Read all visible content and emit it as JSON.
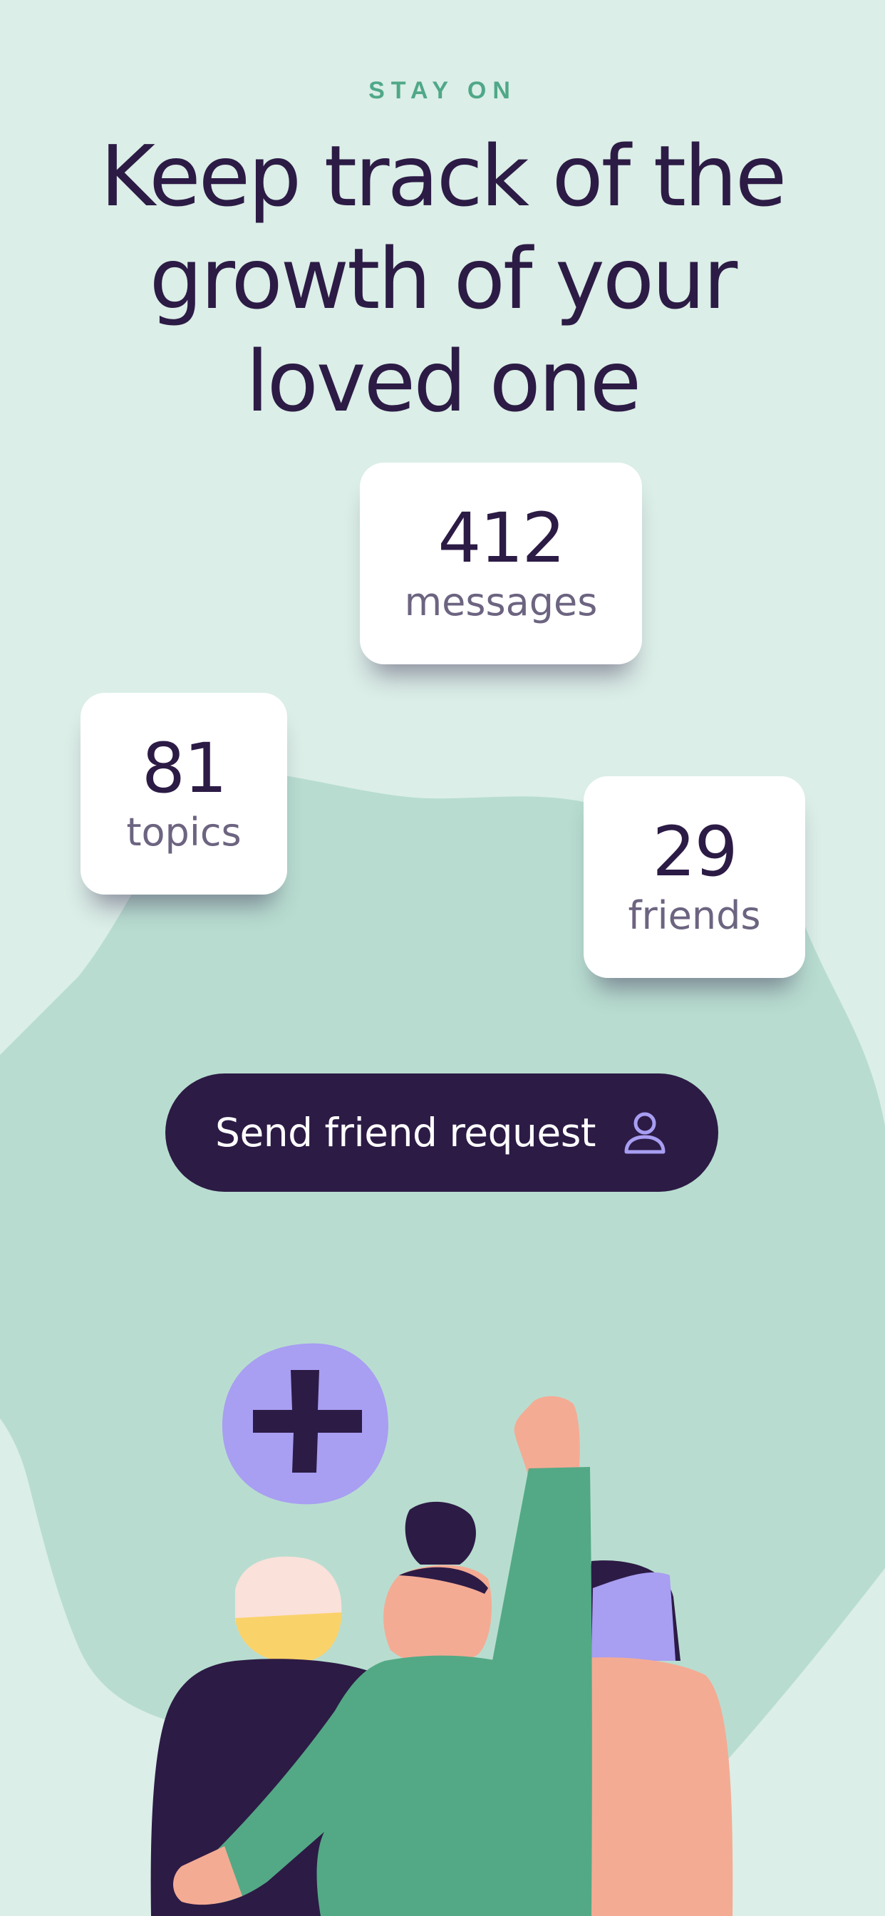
{
  "header": {
    "eyebrow": "STAY ON",
    "headline": "Keep track of the growth of your loved one"
  },
  "stats": {
    "messages": {
      "value": "412",
      "label": "messages"
    },
    "topics": {
      "value": "81",
      "label": "topics"
    },
    "friends": {
      "value": "29",
      "label": "friends"
    }
  },
  "cta": {
    "label": "Send friend request",
    "icon": "user-icon"
  },
  "illustration": {
    "icon": "plus-icon"
  },
  "colors": {
    "background": "#dbeee7",
    "blob": "#b8ddd0",
    "accent_green": "#4fa888",
    "dark_purple": "#2c1b45",
    "lavender": "#a89ef2",
    "skin": "#f4ab94"
  }
}
